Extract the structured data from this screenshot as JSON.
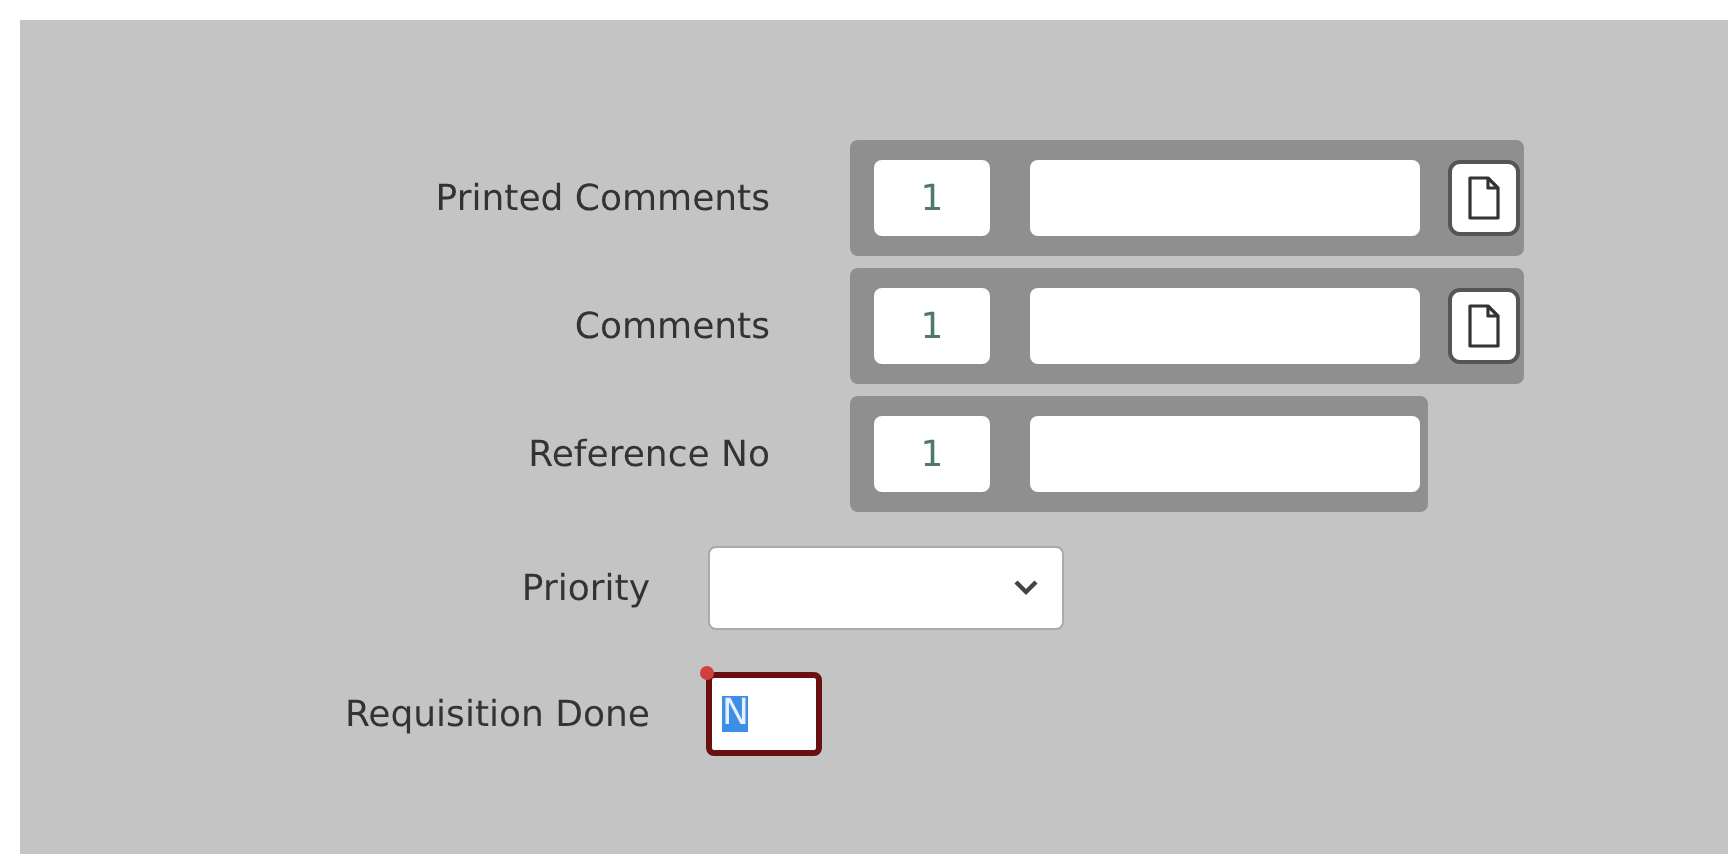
{
  "fields": [
    {
      "label": "Printed Comments",
      "kind": "multi",
      "count": "1",
      "attachment": true
    },
    {
      "label": "Comments",
      "kind": "multi",
      "count": "1",
      "attachment": true
    },
    {
      "label": "Reference No",
      "kind": "multi",
      "count": "1",
      "attachment": false
    },
    {
      "label": "Priority",
      "kind": "select"
    },
    {
      "label": "Requisition Done",
      "kind": "flag",
      "value": "N",
      "focused": true,
      "marked": true
    }
  ]
}
